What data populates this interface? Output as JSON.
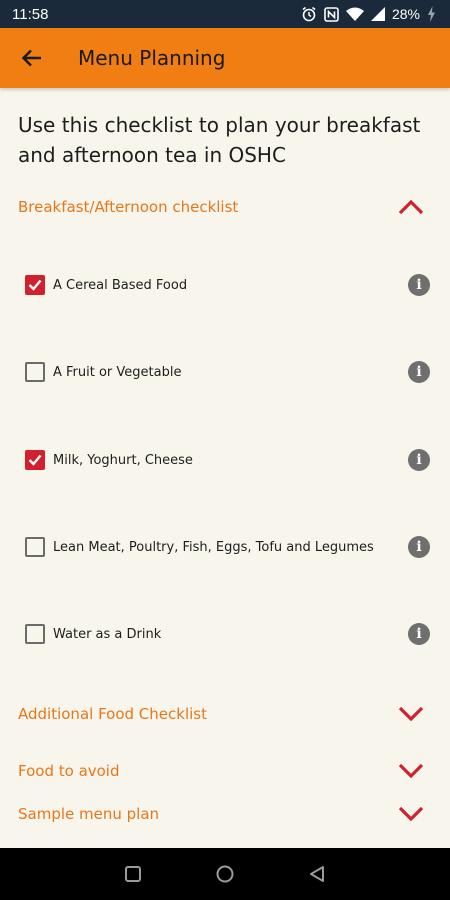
{
  "status_bar": {
    "time": "11:58",
    "battery_text": "28%",
    "icons": [
      "alarm-icon",
      "nfc-icon",
      "wifi-icon",
      "signal-icon",
      "battery-charging-icon"
    ]
  },
  "app_bar": {
    "title": "Menu Planning",
    "back_icon": "arrow-back-icon",
    "background_color": "#f07e12"
  },
  "intro_text": "Use this checklist to plan your breakfast and afternoon tea in OSHC",
  "accent_color": "#e8771a",
  "checkbox_color": "#d3202e",
  "sections": [
    {
      "label": "Breakfast/Afternoon checklist",
      "expanded": true,
      "items": [
        {
          "label": "A Cereal Based Food",
          "checked": true
        },
        {
          "label": "A Fruit or Vegetable",
          "checked": false
        },
        {
          "label": "Milk, Yoghurt, Cheese",
          "checked": true
        },
        {
          "label": "Lean Meat, Poultry, Fish, Eggs, Tofu and Legumes",
          "checked": false
        },
        {
          "label": "Water as a Drink",
          "checked": false
        }
      ]
    },
    {
      "label": "Additional Food Checklist",
      "expanded": false
    },
    {
      "label": "Food to avoid",
      "expanded": false
    },
    {
      "label": "Sample menu plan",
      "expanded": false
    }
  ],
  "nav_bar": {
    "buttons": [
      "recents-square-icon",
      "home-circle-icon",
      "back-triangle-icon"
    ]
  }
}
